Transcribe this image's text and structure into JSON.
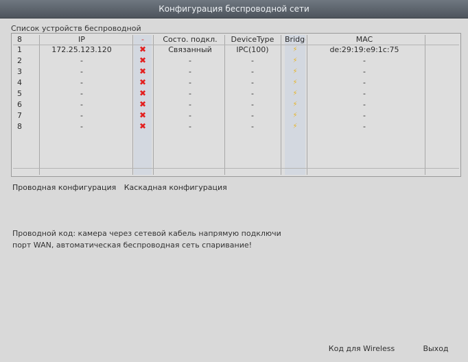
{
  "window": {
    "title": "Конфигурация беспроводной сети"
  },
  "list": {
    "label": "Список устройств беспроводной",
    "columns": [
      "8",
      "IP",
      "-",
      "Состо. подкл.",
      "DeviceType",
      "Bridge",
      "MAC"
    ],
    "rows": [
      {
        "no": "1",
        "ip": "172.25.123.120",
        "status": "Связанный",
        "type": "IPC(100)",
        "mac": "de:29:19:e9:1c:75"
      },
      {
        "no": "2",
        "ip": "-",
        "status": "-",
        "type": "-",
        "mac": "-"
      },
      {
        "no": "3",
        "ip": "-",
        "status": "-",
        "type": "-",
        "mac": "-"
      },
      {
        "no": "4",
        "ip": "-",
        "status": "-",
        "type": "-",
        "mac": "-"
      },
      {
        "no": "5",
        "ip": "-",
        "status": "-",
        "type": "-",
        "mac": "-"
      },
      {
        "no": "6",
        "ip": "-",
        "status": "-",
        "type": "-",
        "mac": "-"
      },
      {
        "no": "7",
        "ip": "-",
        "status": "-",
        "type": "-",
        "mac": "-"
      },
      {
        "no": "8",
        "ip": "-",
        "status": "-",
        "type": "-",
        "mac": "-"
      }
    ],
    "delete_icon": "x-mark-icon",
    "bridge_icon": "lightning-icon"
  },
  "tabs": [
    "Проводная конфигурация",
    "Каскадная конфигурация"
  ],
  "description": {
    "line1": "Проводной код: камера через сетевой кабель напрямую подключи",
    "line2": "порт WAN, автоматическая беспроводная сеть спаривание!"
  },
  "buttons": {
    "code": "Код для Wireless",
    "exit": "Выход"
  }
}
